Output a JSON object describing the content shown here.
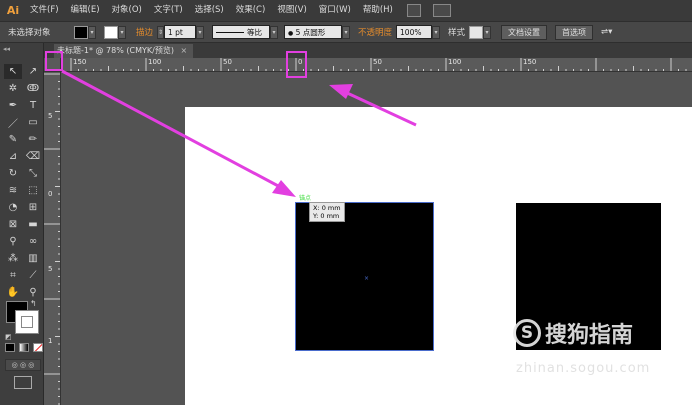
{
  "app": {
    "logo": "Ai"
  },
  "menu": [
    "文件(F)",
    "编辑(E)",
    "对象(O)",
    "文字(T)",
    "选择(S)",
    "效果(C)",
    "视图(V)",
    "窗口(W)",
    "帮助(H)"
  ],
  "control_bar": {
    "selection_label": "未选择对象",
    "stroke_label": "描边",
    "stroke_weight": "1 pt",
    "profile_label": "等比",
    "brush_label": "5 点圆形",
    "opacity_label": "不透明度",
    "opacity_value": "100%",
    "style_label": "样式",
    "doc_setup": "文档设置",
    "preferences": "首选项"
  },
  "document_tab": {
    "title": "未标题-1* @ 78% (CMYK/预览)"
  },
  "ruler": {
    "h_labels": [
      "150",
      "100",
      "50",
      "0",
      "50",
      "100",
      "150"
    ],
    "v_labels": [
      "5",
      "0",
      "5",
      "1"
    ]
  },
  "tooltip": {
    "x": "X: 0 mm",
    "y": "Y: 0 mm"
  },
  "anchor_label": "锚点",
  "watermark": {
    "brand": "搜狗指南",
    "logo_letter": "S",
    "url": "zhinan.sogou.com"
  },
  "colors": {
    "arrow": "#e23fe0",
    "accent_orange": "#e38b2c",
    "selection_blue": "#4a6ccc",
    "anchor_green": "#44dd44"
  }
}
